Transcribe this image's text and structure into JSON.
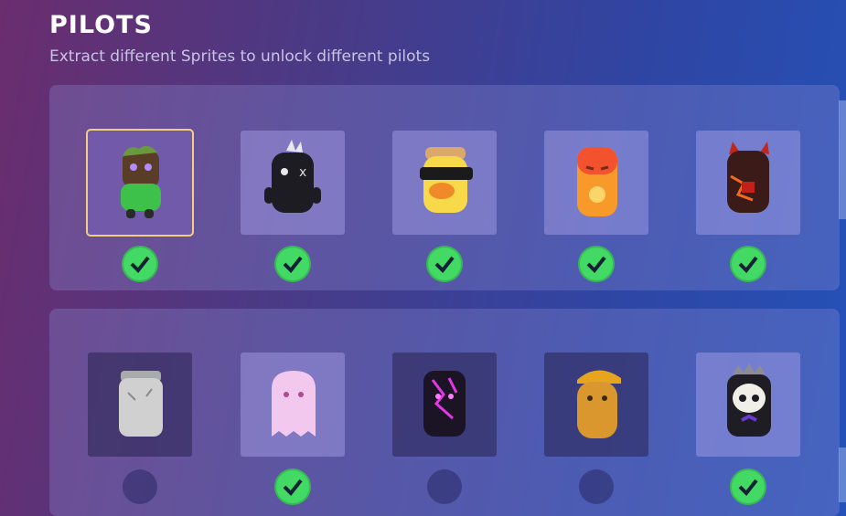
{
  "header": {
    "title": "PILOTS",
    "subtitle": "Extract different Sprites to unlock different pilots"
  },
  "colors": {
    "accent_check": "#42d964",
    "selected_border": "#f2cf7f"
  },
  "pilots": [
    {
      "row": 1,
      "icon": "forest-sprite-icon",
      "unlocked": true,
      "selected": true
    },
    {
      "row": 1,
      "icon": "punk-sprite-icon",
      "unlocked": true,
      "selected": false
    },
    {
      "row": 1,
      "icon": "duck-sunglasses-sprite-icon",
      "unlocked": true,
      "selected": false
    },
    {
      "row": 1,
      "icon": "fire-sprite-icon",
      "unlocked": true,
      "selected": false
    },
    {
      "row": 1,
      "icon": "lava-demon-sprite-icon",
      "unlocked": true,
      "selected": false
    },
    {
      "row": 2,
      "icon": "stone-sprite-icon",
      "unlocked": false,
      "selected": false
    },
    {
      "row": 2,
      "icon": "ghost-sprite-icon",
      "unlocked": true,
      "selected": false
    },
    {
      "row": 2,
      "icon": "void-lightning-sprite-icon",
      "unlocked": false,
      "selected": false
    },
    {
      "row": 2,
      "icon": "peanut-cap-sprite-icon",
      "unlocked": false,
      "selected": false
    },
    {
      "row": 2,
      "icon": "skull-crown-sprite-icon",
      "unlocked": true,
      "selected": false
    }
  ]
}
